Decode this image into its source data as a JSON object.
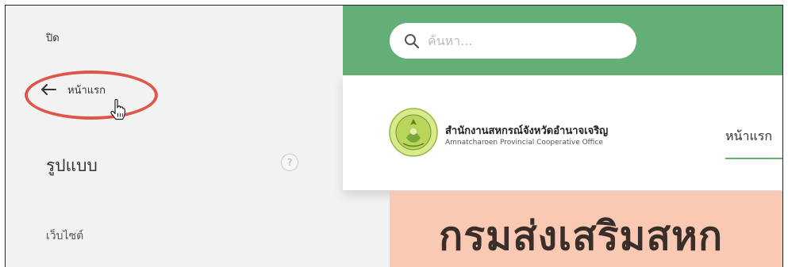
{
  "panel": {
    "close_label": "ปิด",
    "back_label": "หน้าแรก",
    "section_title": "รูปแบบ",
    "help_glyph": "?",
    "sub_label": "เว็บไซต์"
  },
  "preview": {
    "search": {
      "placeholder": "ค้นหา..."
    },
    "site": {
      "name_th": "สำนักงานสหกรณ์จังหวัดอำนาจเจริญ",
      "name_en": "Amnatcharoen Provincial Cooperative Office"
    },
    "nav": {
      "home": "หน้าแรก"
    },
    "banner_text": "กรมส่งเสริมสหก"
  },
  "colors": {
    "panel_bg": "#f2f2f2",
    "header_green": "#64af78",
    "highlight_red": "#e05549",
    "banner_bg": "#f9c9b3"
  },
  "icons": [
    "back-arrow-icon",
    "hand-cursor-icon",
    "help-icon",
    "search-icon",
    "logo"
  ]
}
